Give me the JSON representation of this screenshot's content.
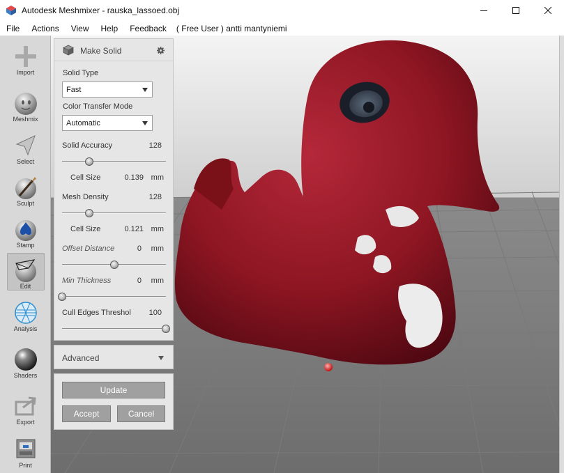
{
  "window": {
    "title": "Autodesk Meshmixer - rauska_lassoed.obj",
    "minimize": "—",
    "maximize": "☐",
    "close": "✕"
  },
  "menu": {
    "items": [
      "File",
      "Actions",
      "View",
      "Help",
      "Feedback"
    ],
    "user": "( Free User ) antti mantyniemi"
  },
  "toolbar": {
    "tools": [
      {
        "label": "Import",
        "icon": "import-icon"
      },
      {
        "label": "Meshmix",
        "icon": "meshmix-icon"
      },
      {
        "label": "Select",
        "icon": "select-icon"
      },
      {
        "label": "Sculpt",
        "icon": "sculpt-icon"
      },
      {
        "label": "Stamp",
        "icon": "stamp-icon"
      },
      {
        "label": "Edit",
        "icon": "edit-icon",
        "active": true
      },
      {
        "label": "Analysis",
        "icon": "analysis-icon"
      },
      {
        "label": "Shaders",
        "icon": "shaders-icon"
      },
      {
        "label": "Export",
        "icon": "export-icon"
      },
      {
        "label": "Print",
        "icon": "print-icon"
      }
    ]
  },
  "panel": {
    "title": "Make Solid",
    "solid_type": {
      "label": "Solid Type",
      "value": "Fast"
    },
    "color_transfer": {
      "label": "Color Transfer Mode",
      "value": "Automatic"
    },
    "solid_accuracy": {
      "label": "Solid Accuracy",
      "value": "128",
      "slider_fraction": 0.26
    },
    "cell_size_1": {
      "label": "Cell Size",
      "value": "0.139",
      "unit": "mm"
    },
    "mesh_density": {
      "label": "Mesh Density",
      "value": "128",
      "slider_fraction": 0.26
    },
    "cell_size_2": {
      "label": "Cell Size",
      "value": "0.121",
      "unit": "mm"
    },
    "offset_distance": {
      "label": "Offset Distance",
      "value": "0",
      "unit": "mm",
      "slider_fraction": 0.5
    },
    "min_thickness": {
      "label": "Min Thickness",
      "value": "0",
      "unit": "mm",
      "slider_fraction": 0.0
    },
    "cull_edges": {
      "label": "Cull Edges Threshol",
      "value": "100",
      "slider_fraction": 1.0
    }
  },
  "advanced": {
    "label": "Advanced"
  },
  "buttons": {
    "update": "Update",
    "accept": "Accept",
    "cancel": "Cancel"
  },
  "colors": {
    "duck": "#8e1622",
    "toolbar_bg": "#d8d8d8",
    "panel_bg": "#e6e6e6",
    "button": "#a0a0a0"
  }
}
